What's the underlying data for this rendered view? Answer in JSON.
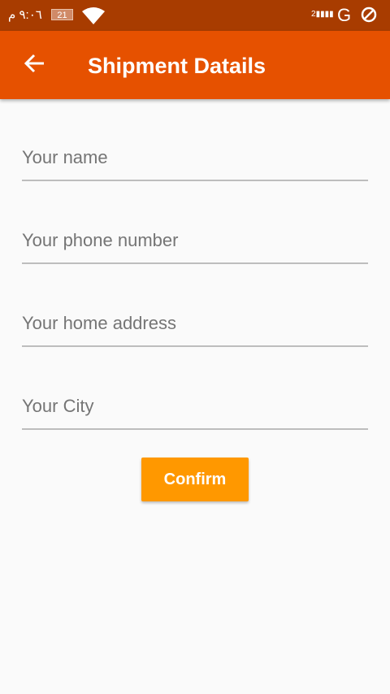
{
  "status": {
    "time": "٩:٠٦ م",
    "battery": "21",
    "signal": "2",
    "network": "G"
  },
  "appbar": {
    "title": "Shipment Datails"
  },
  "fields": [
    {
      "placeholder": "Your name"
    },
    {
      "placeholder": "Your phone number"
    },
    {
      "placeholder": "Your home address"
    },
    {
      "placeholder": "Your City"
    }
  ],
  "confirm_label": "Confirm"
}
